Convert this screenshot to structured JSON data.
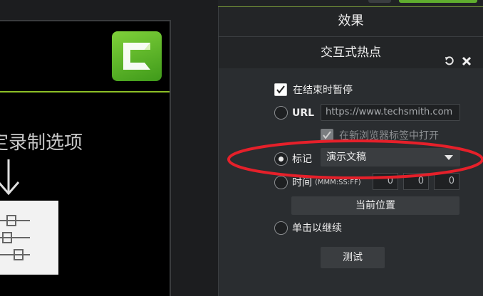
{
  "panel": {
    "title": "效果",
    "section_title": "交互式热点"
  },
  "options": {
    "pause_at_end": "在结束时暂停",
    "url_label": "URL",
    "url_placeholder": "https://www.techsmith.com",
    "open_new_tab": "在新浏览器标签中打开",
    "marker_label": "标记",
    "marker_value": "演示文稿",
    "time_label": "时间",
    "time_format": "(MMM:SS:FF)",
    "time_values": [
      "0",
      "0",
      "0"
    ],
    "current_position_button": "当前位置",
    "click_continue": "单击以继续",
    "test_button": "测试"
  },
  "canvas": {
    "record_text": "定录制选项"
  },
  "colors": {
    "accent_green": "#8cbf26",
    "annotation_red": "#e5202a"
  }
}
